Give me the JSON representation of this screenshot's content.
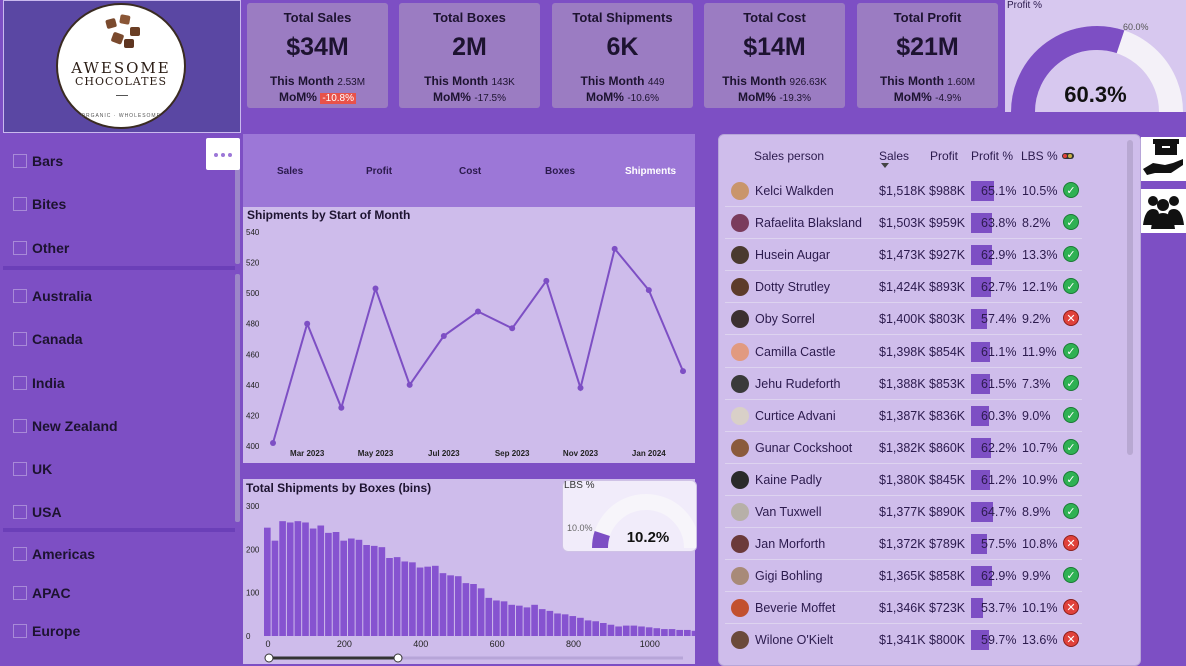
{
  "logo": {
    "line1": "AWESOME",
    "line2": "CHOCOLATES",
    "tagline": "ORGANIC · WHOLESOME"
  },
  "kpis": [
    {
      "title": "Total Sales",
      "value": "$34M",
      "month_label": "This Month",
      "month_value": "2.53M",
      "mom_label": "MoM%",
      "mom_value": "-10.8%",
      "mom_highlight": true
    },
    {
      "title": "Total Boxes",
      "value": "2M",
      "month_label": "This Month",
      "month_value": "143K",
      "mom_label": "MoM%",
      "mom_value": "-17.5%",
      "mom_highlight": false
    },
    {
      "title": "Total Shipments",
      "value": "6K",
      "month_label": "This Month",
      "month_value": "449",
      "mom_label": "MoM%",
      "mom_value": "-10.6%",
      "mom_highlight": false
    },
    {
      "title": "Total Cost",
      "value": "$14M",
      "month_label": "This Month",
      "month_value": "926.63K",
      "mom_label": "MoM%",
      "mom_value": "-19.3%",
      "mom_highlight": false
    },
    {
      "title": "Total Profit",
      "value": "$21M",
      "month_label": "This Month",
      "month_value": "1.60M",
      "mom_label": "MoM%",
      "mom_value": "-4.9%",
      "mom_highlight": false
    }
  ],
  "profit_gauge": {
    "label": "Profit %",
    "value": "60.3%",
    "target": "60.0%",
    "fraction": 0.603
  },
  "filters": {
    "products": [
      "Bars",
      "Bites",
      "Other"
    ],
    "countries": [
      "Australia",
      "Canada",
      "India",
      "New Zealand",
      "UK",
      "USA"
    ],
    "regions": [
      "Americas",
      "APAC",
      "Europe"
    ]
  },
  "nav_tabs": [
    "Sales",
    "Profit",
    "Cost",
    "Boxes",
    "Shipments"
  ],
  "active_tab": "Shipments",
  "line_chart": {
    "title": "Shipments by Start of Month"
  },
  "hist_chart": {
    "title": "Total Shipments by Boxes (bins)"
  },
  "lbs_gauge": {
    "label": "LBS %",
    "value": "10.2%",
    "target": "10.0%",
    "fraction": 0.102
  },
  "chart_data": [
    {
      "type": "line",
      "title": "Shipments by Start of Month",
      "x": [
        "Feb 2023",
        "Mar 2023",
        "Apr 2023",
        "May 2023",
        "Jun 2023",
        "Jul 2023",
        "Aug 2023",
        "Sep 2023",
        "Oct 2023",
        "Nov 2023",
        "Dec 2023",
        "Jan 2024",
        "Feb 2024"
      ],
      "x_tick_labels": [
        "Mar 2023",
        "May 2023",
        "Jul 2023",
        "Sep 2023",
        "Nov 2023",
        "Jan 2024"
      ],
      "values": [
        402,
        480,
        425,
        503,
        440,
        472,
        488,
        477,
        508,
        438,
        529,
        502,
        449
      ],
      "ylim": [
        400,
        540
      ],
      "y_ticks": [
        400,
        420,
        440,
        460,
        480,
        500,
        520,
        540
      ]
    },
    {
      "type": "bar",
      "title": "Total Shipments by Boxes (bins)",
      "x_start": 0,
      "bin_width": 20,
      "values": [
        250,
        220,
        265,
        262,
        265,
        262,
        248,
        255,
        238,
        240,
        220,
        225,
        222,
        210,
        208,
        205,
        180,
        182,
        172,
        170,
        158,
        160,
        162,
        145,
        140,
        138,
        122,
        120,
        110,
        88,
        82,
        80,
        72,
        70,
        66,
        72,
        62,
        58,
        52,
        50,
        46,
        42,
        36,
        34,
        30,
        26,
        22,
        24,
        24,
        22,
        20,
        18,
        16,
        16,
        14,
        14,
        12,
        12
      ],
      "x_ticks": [
        0,
        200,
        400,
        600,
        800,
        1000
      ],
      "y_ticks": [
        0,
        100,
        200,
        300
      ],
      "ylim": [
        0,
        300
      ]
    }
  ],
  "table": {
    "headers": {
      "name": "Sales person",
      "sales": "Sales",
      "profit": "Profit",
      "profit_pct": "Profit %",
      "lbs_pct": "LBS %"
    },
    "rows": [
      {
        "name": "Kelci Walkden",
        "sales": "$1,518K",
        "profit": "$988K",
        "profit_pct": "65.1%",
        "pct": 65.1,
        "lbs": "10.5%",
        "ok": true,
        "avatar": "#c9956b"
      },
      {
        "name": "Rafaelita Blaksland",
        "sales": "$1,503K",
        "profit": "$959K",
        "profit_pct": "63.8%",
        "pct": 63.8,
        "lbs": "8.2%",
        "ok": true,
        "avatar": "#7a3b5c"
      },
      {
        "name": "Husein Augar",
        "sales": "$1,473K",
        "profit": "$927K",
        "profit_pct": "62.9%",
        "pct": 62.9,
        "lbs": "13.3%",
        "ok": true,
        "avatar": "#4a3a2f"
      },
      {
        "name": "Dotty Strutley",
        "sales": "$1,424K",
        "profit": "$893K",
        "profit_pct": "62.7%",
        "pct": 62.7,
        "lbs": "12.1%",
        "ok": true,
        "avatar": "#5d3b2a"
      },
      {
        "name": "Oby Sorrel",
        "sales": "$1,400K",
        "profit": "$803K",
        "profit_pct": "57.4%",
        "pct": 57.4,
        "lbs": "9.2%",
        "ok": false,
        "avatar": "#3c3030"
      },
      {
        "name": "Camilla Castle",
        "sales": "$1,398K",
        "profit": "$854K",
        "profit_pct": "61.1%",
        "pct": 61.1,
        "lbs": "11.9%",
        "ok": true,
        "avatar": "#e19a80"
      },
      {
        "name": "Jehu Rudeforth",
        "sales": "$1,388K",
        "profit": "$853K",
        "profit_pct": "61.5%",
        "pct": 61.5,
        "lbs": "7.3%",
        "ok": true,
        "avatar": "#3a3a3a"
      },
      {
        "name": "Curtice Advani",
        "sales": "$1,387K",
        "profit": "$836K",
        "profit_pct": "60.3%",
        "pct": 60.3,
        "lbs": "9.0%",
        "ok": true,
        "avatar": "#d9d0c8"
      },
      {
        "name": "Gunar Cockshoot",
        "sales": "$1,382K",
        "profit": "$860K",
        "profit_pct": "62.2%",
        "pct": 62.2,
        "lbs": "10.7%",
        "ok": true,
        "avatar": "#8a5a3c"
      },
      {
        "name": "Kaine Padly",
        "sales": "$1,380K",
        "profit": "$845K",
        "profit_pct": "61.2%",
        "pct": 61.2,
        "lbs": "10.9%",
        "ok": true,
        "avatar": "#2a2a2a"
      },
      {
        "name": "Van Tuxwell",
        "sales": "$1,377K",
        "profit": "$890K",
        "profit_pct": "64.7%",
        "pct": 64.7,
        "lbs": "8.9%",
        "ok": true,
        "avatar": "#b7b0a8"
      },
      {
        "name": "Jan Morforth",
        "sales": "$1,372K",
        "profit": "$789K",
        "profit_pct": "57.5%",
        "pct": 57.5,
        "lbs": "10.8%",
        "ok": false,
        "avatar": "#6b3a3a"
      },
      {
        "name": "Gigi Bohling",
        "sales": "$1,365K",
        "profit": "$858K",
        "profit_pct": "62.9%",
        "pct": 62.9,
        "lbs": "9.9%",
        "ok": true,
        "avatar": "#a88a78"
      },
      {
        "name": "Beverie Moffet",
        "sales": "$1,346K",
        "profit": "$723K",
        "profit_pct": "53.7%",
        "pct": 53.7,
        "lbs": "10.1%",
        "ok": false,
        "avatar": "#c2502f"
      },
      {
        "name": "Wilone O'Kielt",
        "sales": "$1,341K",
        "profit": "$800K",
        "profit_pct": "59.7%",
        "pct": 59.7,
        "lbs": "13.6%",
        "ok": false,
        "avatar": "#6b4a3a"
      }
    ]
  },
  "colors": {
    "accent": "#7d4fc4",
    "ok": "#2fb153",
    "bad": "#e0413a",
    "neg_badge": "#e8524a"
  },
  "right_icons": [
    "product-box-hand-icon",
    "people-group-icon"
  ]
}
